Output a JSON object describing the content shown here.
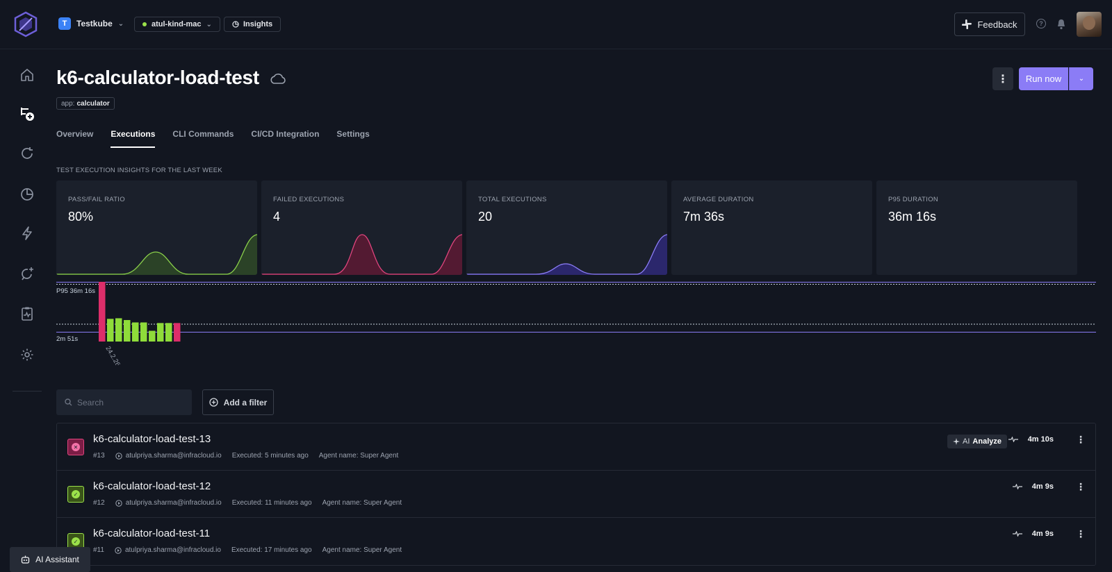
{
  "topbar": {
    "org_initial": "T",
    "org_name": "Testkube",
    "environment": "atul-kind-mac",
    "insights_label": "Insights",
    "feedback_label": "Feedback",
    "help_glyph": "?"
  },
  "sidebar": {
    "items": [
      "home-icon",
      "add-test-icon",
      "refresh-icon",
      "pie-chart-icon",
      "bolt-icon",
      "sync-add-icon",
      "clipboard-pulse-icon",
      "gear-icon"
    ]
  },
  "header": {
    "title": "k6-calculator-load-test",
    "label_key": "app:",
    "label_value": "calculator",
    "more_glyph": "⋮",
    "run_label": "Run now"
  },
  "tabs": [
    "Overview",
    "Executions",
    "CLI Commands",
    "CI/CD Integration",
    "Settings"
  ],
  "active_tab": "Executions",
  "insights_title": "TEST EXECUTION INSIGHTS FOR THE LAST WEEK",
  "stats": [
    {
      "label": "PASS/FAIL RATIO",
      "value": "80%",
      "color": "#8ad04a"
    },
    {
      "label": "FAILED EXECUTIONS",
      "value": "4",
      "color": "#e0457e"
    },
    {
      "label": "TOTAL EXECUTIONS",
      "value": "20",
      "color": "#8b7cf6"
    },
    {
      "label": "AVERAGE DURATION",
      "value": "7m 36s"
    },
    {
      "label": "P95 DURATION",
      "value": "36m 16s"
    }
  ],
  "chart_data": {
    "type": "bar",
    "p95_label": "P95 36m 16s",
    "min_label": "2m 51s",
    "x_tick": "24.2.26",
    "bars": [
      {
        "status": "failed",
        "value": 1.0
      },
      {
        "status": "passed",
        "value": 0.38
      },
      {
        "status": "passed",
        "value": 0.39
      },
      {
        "status": "passed",
        "value": 0.36
      },
      {
        "status": "passed",
        "value": 0.32
      },
      {
        "status": "passed",
        "value": 0.32
      },
      {
        "status": "passed",
        "value": 0.18
      },
      {
        "status": "passed",
        "value": 0.31
      },
      {
        "status": "passed",
        "value": 0.31
      },
      {
        "status": "failed",
        "value": 0.31
      }
    ],
    "colors": {
      "failed": "#dd2e6a",
      "passed": "#8fdc3a",
      "line": "#8b7cf6"
    }
  },
  "filters": {
    "search_placeholder": "Search",
    "add_filter_label": "Add a filter"
  },
  "executions": [
    {
      "name": "k6-calculator-load-test-13",
      "number": "#13",
      "user": "atulpriya.sharma@infracloud.io",
      "executed": "Executed: 5 minutes ago",
      "agent": "Agent name: Super Agent",
      "duration": "4m 10s",
      "status": "failed",
      "status_glyph": "✕",
      "ai_prefix": "AI",
      "ai_label": "Analyze"
    },
    {
      "name": "k6-calculator-load-test-12",
      "number": "#12",
      "user": "atulpriya.sharma@infracloud.io",
      "executed": "Executed: 11 minutes ago",
      "agent": "Agent name: Super Agent",
      "duration": "4m 9s",
      "status": "passed",
      "status_glyph": "✓"
    },
    {
      "name": "k6-calculator-load-test-11",
      "number": "#11",
      "user": "atulpriya.sharma@infracloud.io",
      "executed": "Executed: 17 minutes ago",
      "agent": "Agent name: Super Agent",
      "duration": "4m 9s",
      "status": "passed",
      "status_glyph": "✓"
    }
  ],
  "ai_assistant_label": "AI Assistant"
}
